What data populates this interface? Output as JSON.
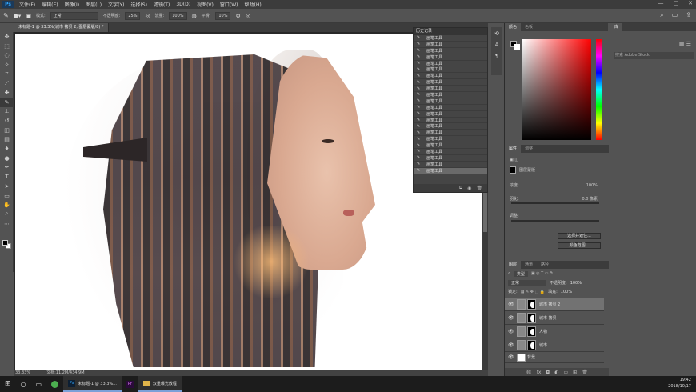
{
  "menubar": {
    "logo": "Ps",
    "items": [
      "文件(F)",
      "编辑(E)",
      "图像(I)",
      "图层(L)",
      "文字(Y)",
      "选择(S)",
      "滤镜(T)",
      "3D(D)",
      "视图(V)",
      "窗口(W)",
      "帮助(H)"
    ],
    "window_controls": [
      "—",
      "□",
      "✕"
    ]
  },
  "options": {
    "mode_label": "模式:",
    "mode_value": "正常",
    "opacity_label": "不透明度:",
    "opacity_value": "25%",
    "flow_label": "流量:",
    "flow_value": "100%",
    "smooth_label": "平滑:",
    "smooth_value": "10%"
  },
  "document": {
    "tab_label": "未标题-1 @ 33.3%(城市 拷贝 2, 图层蒙版/8) *",
    "zoom": "33.33%",
    "doc_info": "文档:11.2M/434.9M"
  },
  "history": {
    "title": "历史记录",
    "items": [
      "画笔工具",
      "画笔工具",
      "画笔工具",
      "画笔工具",
      "画笔工具",
      "画笔工具",
      "画笔工具",
      "画笔工具",
      "画笔工具",
      "画笔工具",
      "画笔工具",
      "画笔工具",
      "画笔工具",
      "画笔工具",
      "画笔工具",
      "画笔工具",
      "画笔工具",
      "画笔工具",
      "画笔工具",
      "画笔工具",
      "画笔工具",
      "画笔工具"
    ]
  },
  "color_panel": {
    "tabs": [
      "颜色",
      "色板"
    ],
    "accent": "#ff0000"
  },
  "properties": {
    "tabs": [
      "属性",
      "调整"
    ],
    "mask_label": "图层蒙版",
    "density_label": "浓度:",
    "density_value": "100%",
    "feather_label": "羽化:",
    "feather_value": "0.0 像素",
    "adjust_label": "调整:",
    "select_subject": "选择并遮住...",
    "color_range": "颜色范围..."
  },
  "layers": {
    "tabs": [
      "图层",
      "通道",
      "路径"
    ],
    "kind_label": "类型",
    "blend_mode": "正常",
    "opacity_label": "不透明度:",
    "opacity_value": "100%",
    "lock_label": "锁定:",
    "fill_label": "填充:",
    "fill_value": "100%",
    "items": [
      {
        "name": "城市 拷贝 2",
        "selected": true
      },
      {
        "name": "城市 拷贝",
        "selected": false
      },
      {
        "name": "人物",
        "selected": false
      },
      {
        "name": "城市",
        "selected": false
      },
      {
        "name": "背景",
        "selected": false
      }
    ]
  },
  "far_right": {
    "tab": "库",
    "search_placeholder": "搜索 Adobe Stock"
  },
  "taskbar": {
    "ps_label": "未标题-1 @ 33.3%...",
    "folder_label": "双重曝光教程",
    "time": "19:42",
    "date": "2018/10/17"
  }
}
